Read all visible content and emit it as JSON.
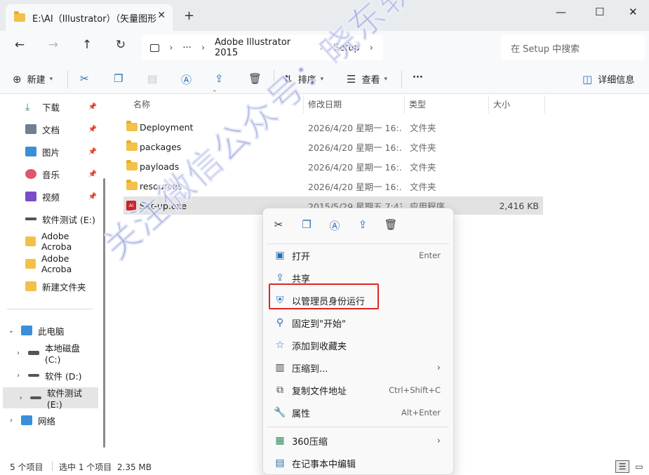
{
  "window": {
    "tab_title": "E:\\AI（Illustrator）（矢量图形",
    "tab_close": "✕",
    "new_tab": "+",
    "minimize": "—",
    "maximize": "☐",
    "close": "✕"
  },
  "address": {
    "ellipsis": "···",
    "crumbs": [
      "Adobe Illustrator 2015",
      "Setup"
    ],
    "search_placeholder": "在 Setup 中搜索"
  },
  "toolbar": {
    "new_label": "新建",
    "sort_label": "排序",
    "view_label": "查看",
    "more_label": "···",
    "details_label": "详细信息"
  },
  "sidebar": {
    "quick_access": [
      {
        "label": "下载",
        "icon": "download-icon"
      },
      {
        "label": "文档",
        "icon": "document-icon"
      },
      {
        "label": "图片",
        "icon": "pictures-icon"
      },
      {
        "label": "音乐",
        "icon": "music-icon"
      },
      {
        "label": "视频",
        "icon": "video-icon"
      },
      {
        "label": "软件测试 (E:)",
        "icon": "drive-icon"
      },
      {
        "label": "Adobe Acroba",
        "icon": "folder-icon"
      },
      {
        "label": "Adobe Acroba",
        "icon": "folder-icon"
      },
      {
        "label": "新建文件夹",
        "icon": "folder-icon"
      }
    ],
    "this_pc": "此电脑",
    "drives": [
      "本地磁盘 (C:)",
      "软件 (D:)",
      "软件测试 (E:)"
    ],
    "network": "网络"
  },
  "filelist": {
    "columns": {
      "name": "名称",
      "date": "修改日期",
      "type": "类型",
      "size": "大小"
    },
    "rows": [
      {
        "name": "Deployment",
        "date": "2026/4/20 星期一 16:...",
        "type": "文件夹",
        "size": ""
      },
      {
        "name": "packages",
        "date": "2026/4/20 星期一 16:...",
        "type": "文件夹",
        "size": ""
      },
      {
        "name": "payloads",
        "date": "2026/4/20 星期一 16:...",
        "type": "文件夹",
        "size": ""
      },
      {
        "name": "resources",
        "date": "2026/4/20 星期一 16:...",
        "type": "文件夹",
        "size": ""
      },
      {
        "name": "Set-up.exe",
        "date": "2015/5/29 星期五 7:43",
        "type": "应用程序",
        "size": "2,416 KB"
      }
    ]
  },
  "status": {
    "item_count": "5 个项目",
    "selected": "选中 1 个项目  2.35 MB"
  },
  "context_menu": {
    "items": [
      {
        "label": "打开",
        "hint": "Enter"
      },
      {
        "label": "共享",
        "hint": ""
      },
      {
        "label": "以管理员身份运行",
        "hint": ""
      },
      {
        "label": "固定到\"开始\"",
        "hint": ""
      },
      {
        "label": "添加到收藏夹",
        "hint": ""
      },
      {
        "label": "压缩到...",
        "hint": ""
      },
      {
        "label": "复制文件地址",
        "hint": "Ctrl+Shift+C"
      },
      {
        "label": "属性",
        "hint": "Alt+Enter"
      },
      {
        "label": "360压缩",
        "hint": ""
      },
      {
        "label": "在记事本中编辑",
        "hint": ""
      }
    ]
  },
  "watermark": "关注微信公众号：晓东软件管家",
  "colors": {
    "accent": "#2a6db5",
    "highlight_border": "#e02424",
    "folder": "#f3c04a"
  }
}
